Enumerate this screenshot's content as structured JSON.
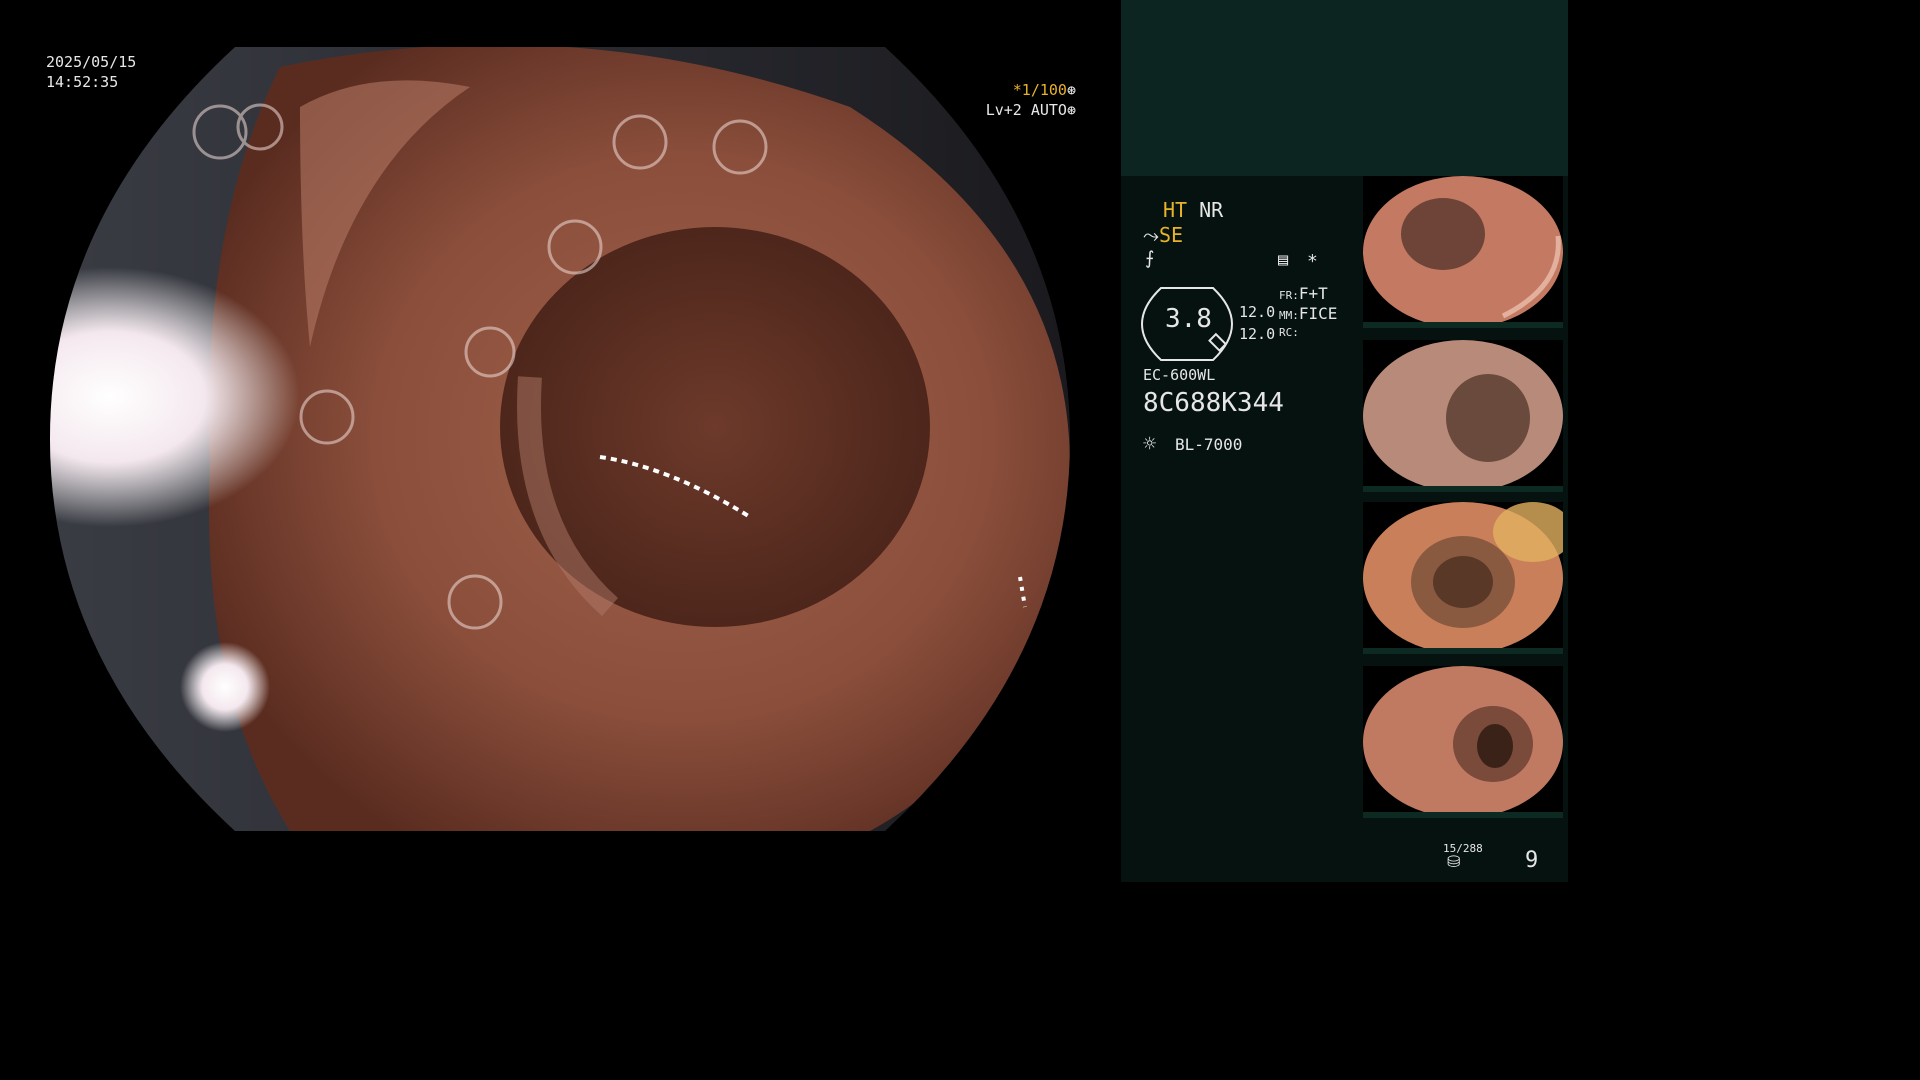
{
  "overlay": {
    "date": "2025/05/15",
    "time": "14:52:35",
    "shutter": "*1/100",
    "level": "Lv+2 AUTO",
    "shutter_icon": "gear-wheel-icon",
    "auto_icon": "iris-icon"
  },
  "panel": {
    "mode_ht": "HT",
    "mode_nr": "NR",
    "se_label": "SE",
    "se_icon": "enhance-curve-icon",
    "freeze_icon": "freeze-mark-icon",
    "asterisk": "*",
    "zoom_value": "3.8",
    "val1": "12.0",
    "val2": "12.0",
    "fr_label": "FR:",
    "fr_value": "F+T",
    "mm_label": "MM:",
    "mm_value": "FICE",
    "rc_label": "RC:",
    "scope_model": "EC-600WL",
    "serial": "8C688K344",
    "light_source": "BL-7000",
    "image_count": "15/288",
    "page_number": "9"
  },
  "colors": {
    "panel_bg": "#05120f",
    "panel_top_bg": "#0c2520",
    "accent_yellow": "#e8b32a"
  }
}
